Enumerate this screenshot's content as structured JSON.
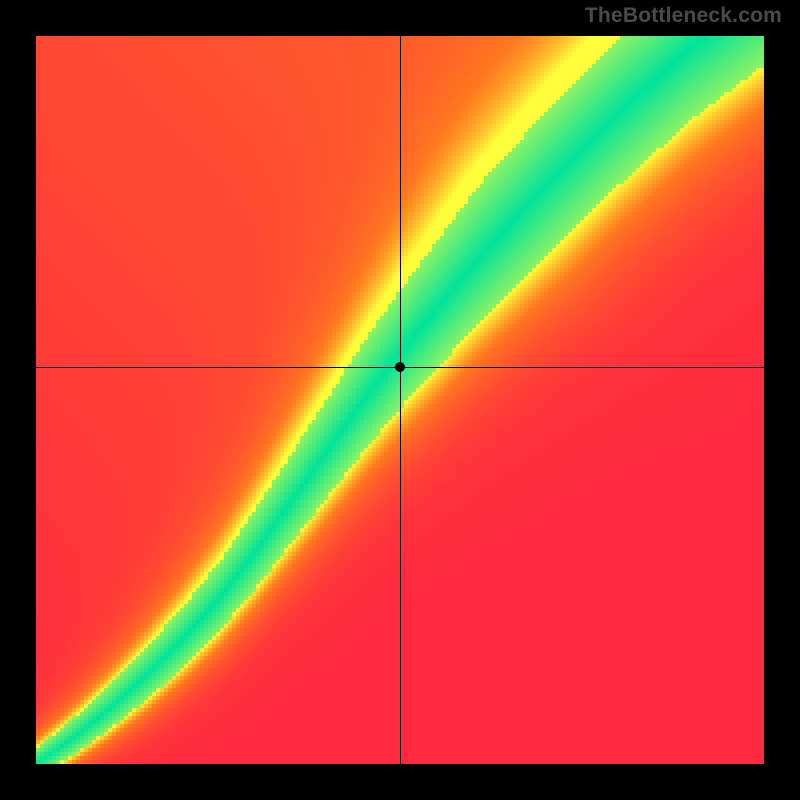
{
  "watermark": "TheBottleneck.com",
  "colors": {
    "red": "#ff2a3f",
    "orange": "#ff7a1f",
    "yellow": "#ffff3a",
    "green": "#00e49a",
    "black": "#000000"
  },
  "chart_data": {
    "type": "heatmap",
    "title": "",
    "xlabel": "",
    "ylabel": "",
    "xlim": [
      0,
      1
    ],
    "ylim": [
      0,
      1
    ],
    "grid": false,
    "legend": "none",
    "marker": {
      "x": 0.5,
      "y": 0.545
    },
    "crosshair": {
      "x": 0.5,
      "y": 0.545
    },
    "optimal_curve": [
      {
        "x": 0.0,
        "y": 0.0
      },
      {
        "x": 0.05,
        "y": 0.035
      },
      {
        "x": 0.1,
        "y": 0.075
      },
      {
        "x": 0.15,
        "y": 0.12
      },
      {
        "x": 0.2,
        "y": 0.17
      },
      {
        "x": 0.25,
        "y": 0.225
      },
      {
        "x": 0.3,
        "y": 0.29
      },
      {
        "x": 0.35,
        "y": 0.36
      },
      {
        "x": 0.4,
        "y": 0.43
      },
      {
        "x": 0.45,
        "y": 0.5
      },
      {
        "x": 0.5,
        "y": 0.565
      },
      {
        "x": 0.55,
        "y": 0.625
      },
      {
        "x": 0.6,
        "y": 0.685
      },
      {
        "x": 0.65,
        "y": 0.74
      },
      {
        "x": 0.7,
        "y": 0.795
      },
      {
        "x": 0.75,
        "y": 0.845
      },
      {
        "x": 0.8,
        "y": 0.895
      },
      {
        "x": 0.85,
        "y": 0.94
      },
      {
        "x": 0.9,
        "y": 0.985
      },
      {
        "x": 0.92,
        "y": 1.0
      }
    ],
    "band_half_width": 0.05,
    "annotations": []
  }
}
